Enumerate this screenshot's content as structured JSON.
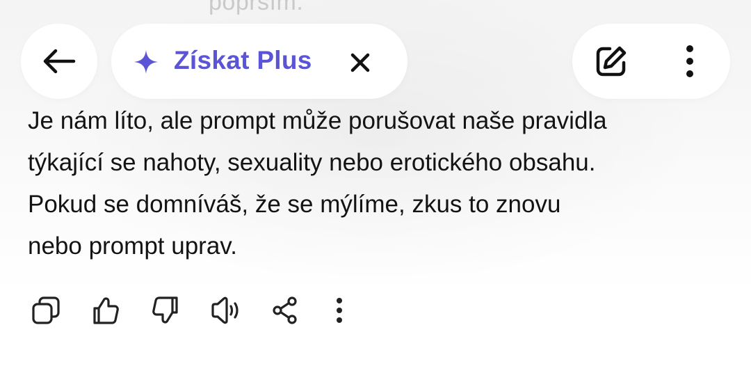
{
  "previous_message_fragment": "poprsím.",
  "header": {
    "back_icon": "arrow-left-icon",
    "upgrade_label": "Získat Plus",
    "upgrade_icon": "sparkle-icon",
    "upgrade_accent_color": "#5b55d6",
    "close_icon": "close-icon",
    "new_chat_icon": "edit-icon",
    "more_icon": "more-vertical-icon"
  },
  "message": {
    "text": "Je nám líto, ale prompt může porušovat naše pravidla\ntýkající se nahoty, sexuality nebo erotického obsahu.\nPokud se domníváš, že se mýlíme, zkus to znovu\nnebo prompt uprav."
  },
  "actions": [
    {
      "icon": "copy-icon"
    },
    {
      "icon": "thumbs-up-icon"
    },
    {
      "icon": "thumbs-down-icon"
    },
    {
      "icon": "speaker-icon"
    },
    {
      "icon": "share-icon"
    },
    {
      "icon": "more-vertical-icon"
    }
  ]
}
